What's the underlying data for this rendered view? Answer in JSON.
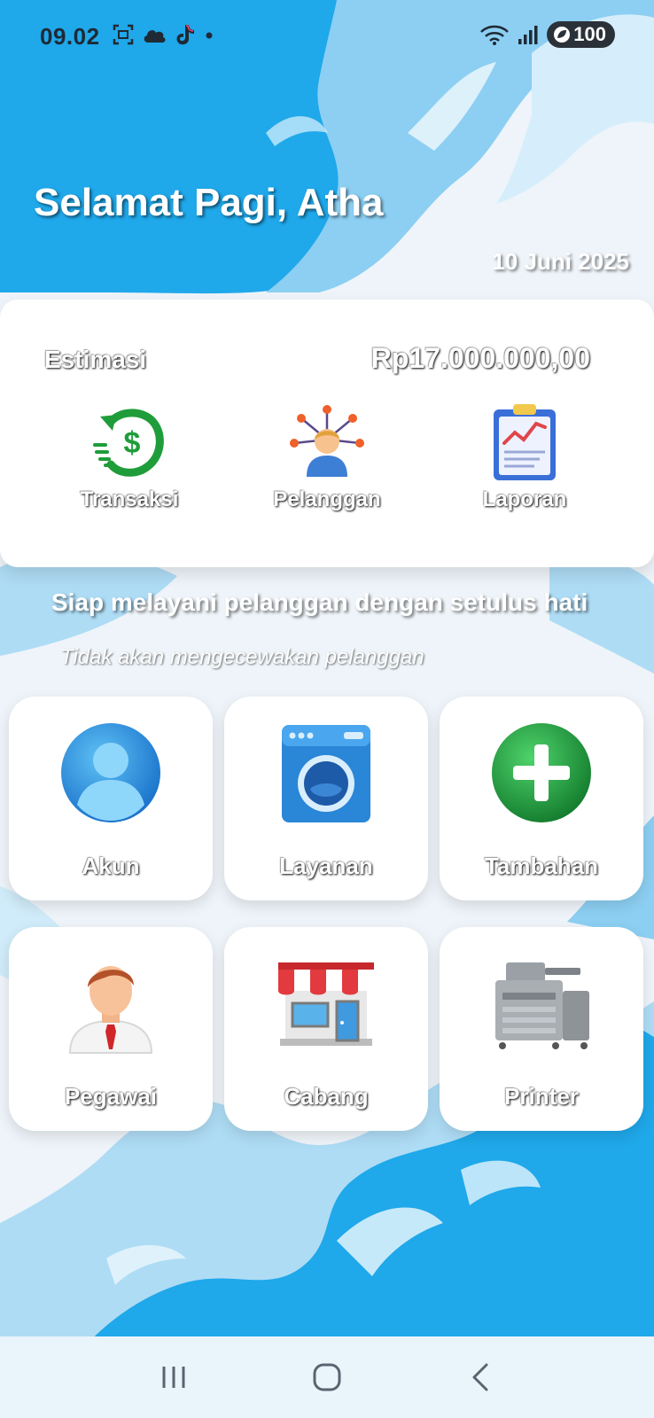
{
  "status_bar": {
    "time": "09.02",
    "icons_left": [
      "screenshot-icon",
      "cloud-icon",
      "tiktok-icon",
      "dot-icon"
    ],
    "icons_right": [
      "wifi-icon",
      "signal-icon"
    ],
    "battery": "100"
  },
  "header": {
    "greeting": "Selamat Pagi, Atha",
    "date": "10 Juni 2025"
  },
  "estimate": {
    "label": "Estimasi",
    "value": "Rp17.000.000,00"
  },
  "quick_actions": [
    {
      "label": "Transaksi",
      "icon": "transaction-dollar-icon"
    },
    {
      "label": "Pelanggan",
      "icon": "customer-network-icon"
    },
    {
      "label": "Laporan",
      "icon": "report-clipboard-icon"
    }
  ],
  "tagline": {
    "main": "Siap melayani pelanggan dengan setulus hati",
    "sub": "Tidak akan mengecewakan pelanggan"
  },
  "menu": [
    {
      "label": "Akun",
      "icon": "account-user-icon"
    },
    {
      "label": "Layanan",
      "icon": "washing-machine-icon"
    },
    {
      "label": "Tambahan",
      "icon": "add-plus-icon"
    },
    {
      "label": "Pegawai",
      "icon": "employee-icon"
    },
    {
      "label": "Cabang",
      "icon": "store-branch-icon"
    },
    {
      "label": "Printer",
      "icon": "printer-icon"
    }
  ],
  "nav": [
    "recent-apps-icon",
    "home-icon",
    "back-icon"
  ],
  "colors": {
    "sky_blue": "#1fa8ea",
    "light_blue": "#aedcf5",
    "card_white": "#ffffff",
    "accent_green": "#1f9d3a",
    "nav_bg": "#e9f4fb"
  }
}
